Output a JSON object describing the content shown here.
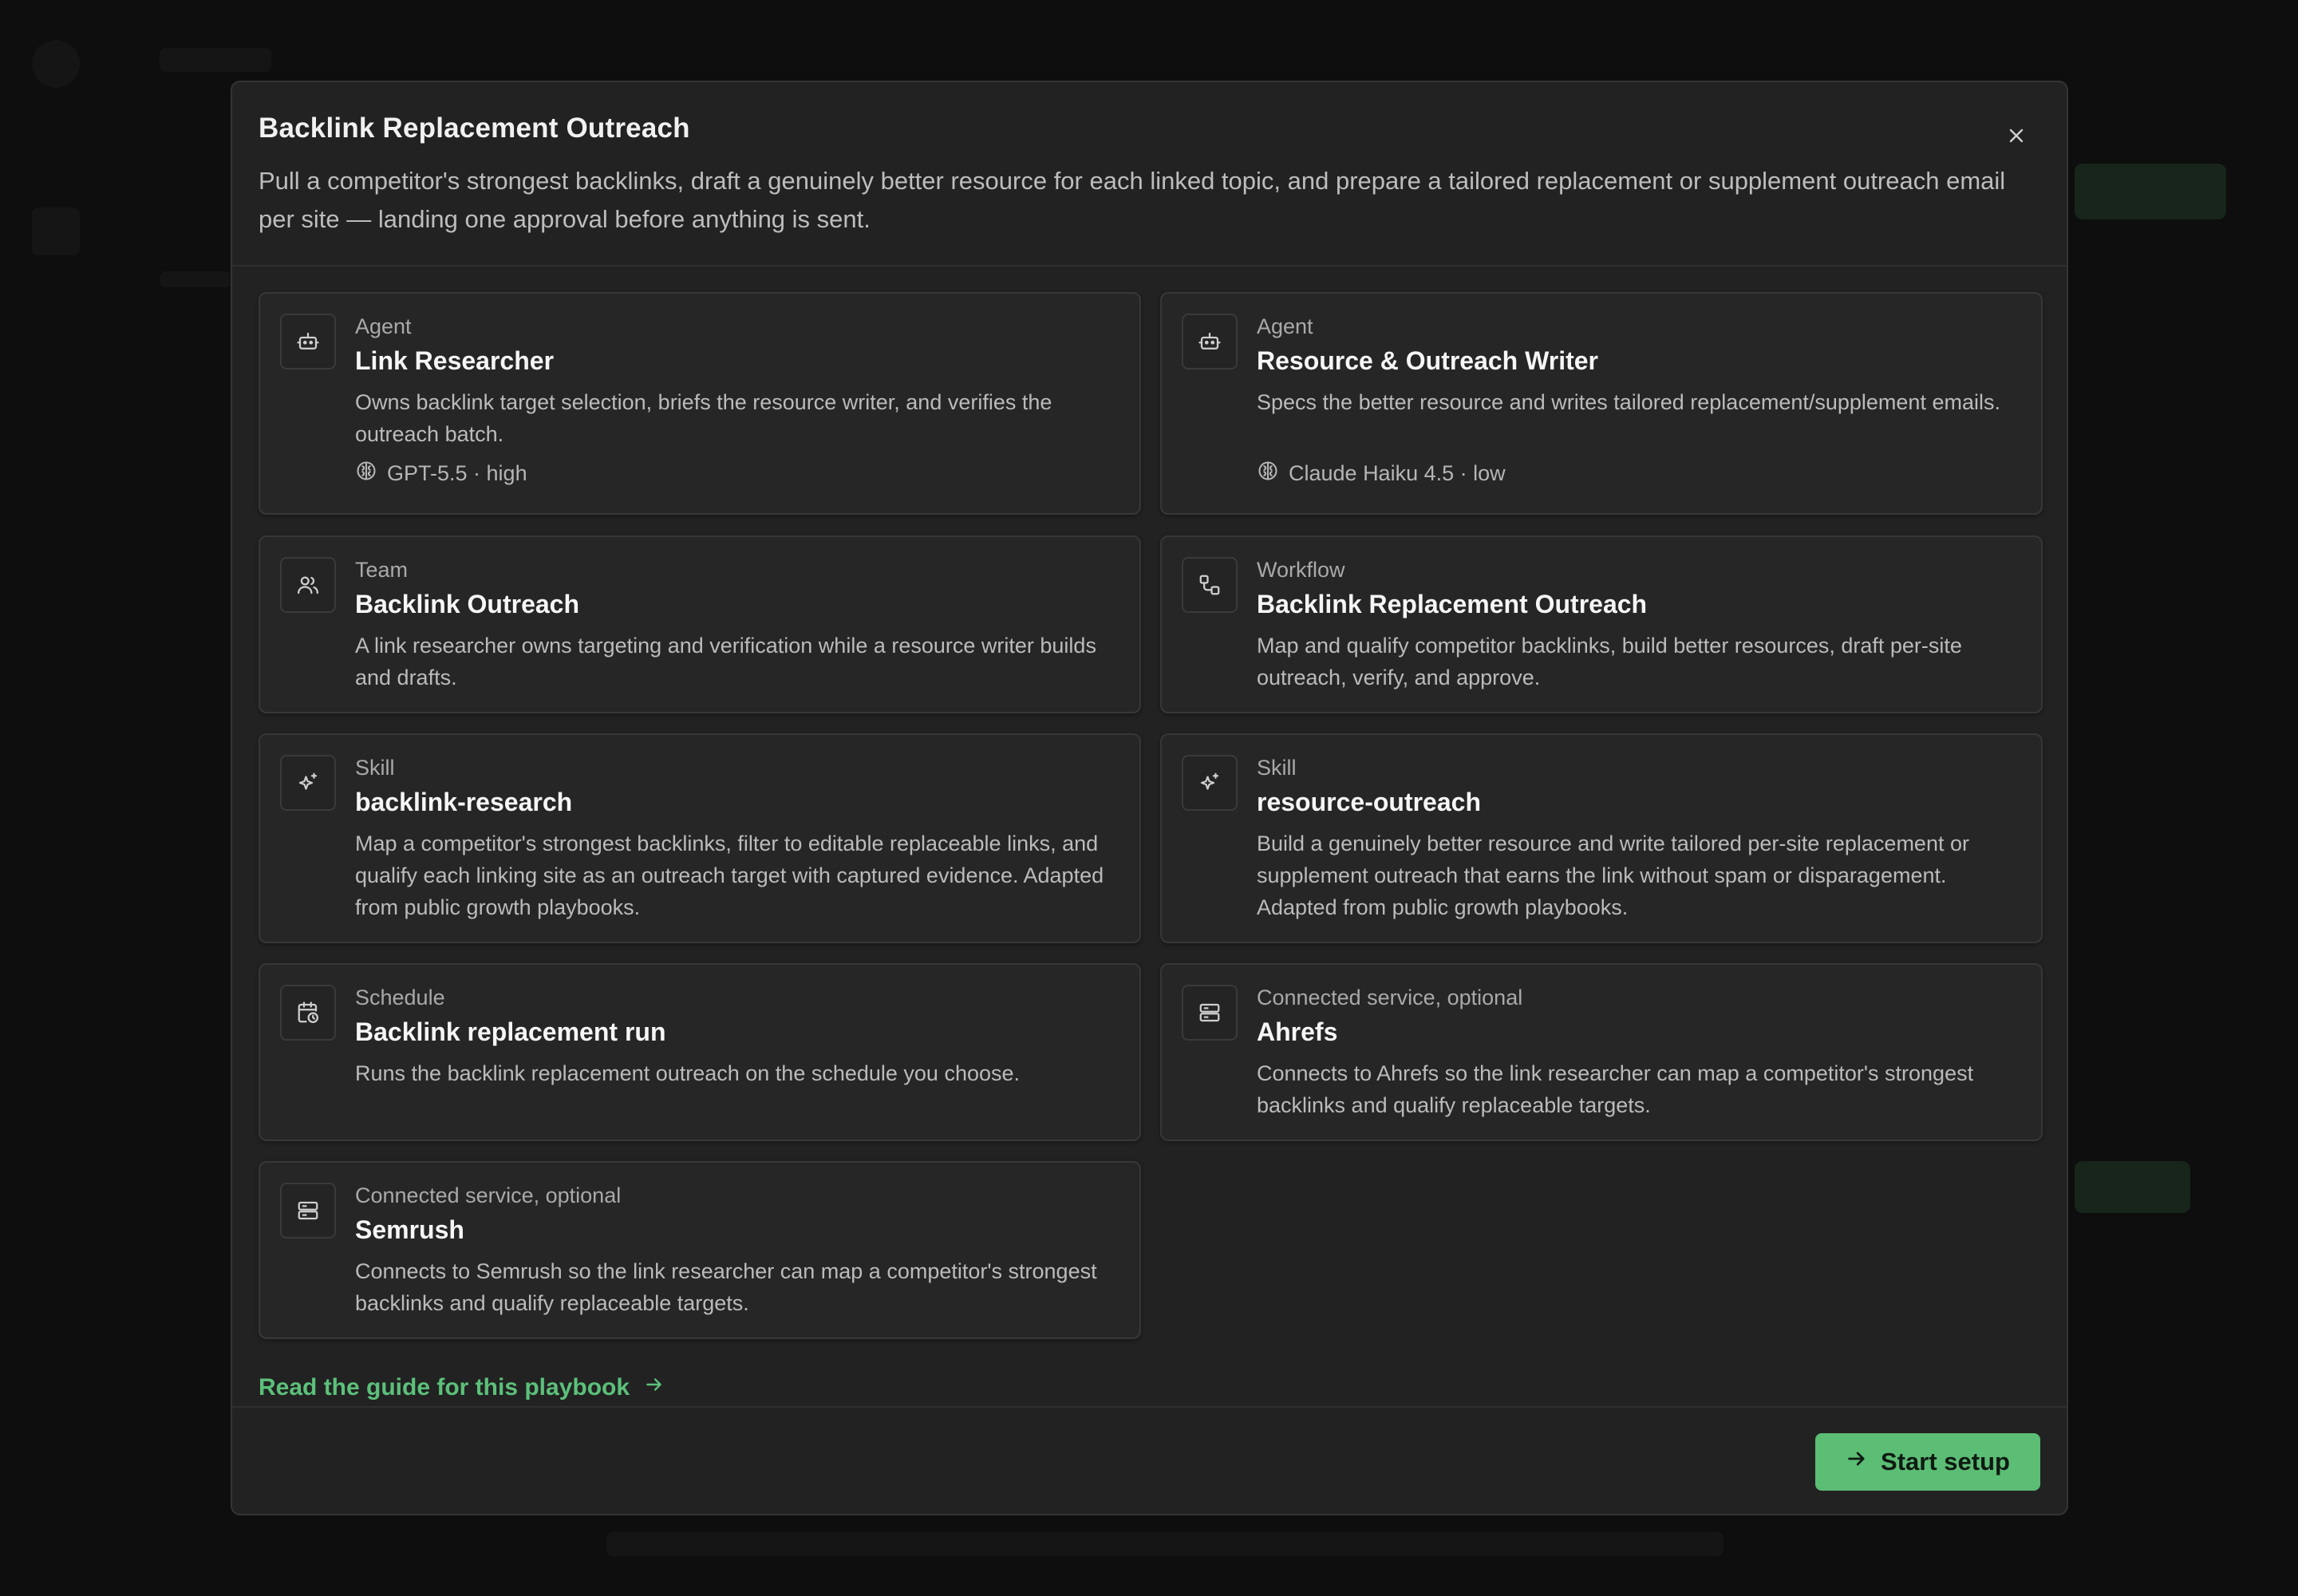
{
  "modal": {
    "title": "Backlink Replacement Outreach",
    "description": "Pull a competitor's strongest backlinks, draft a genuinely better resource for each linked topic, and prepare a tailored replacement or supplement outreach email per site — landing one approval before anything is sent.",
    "close_icon": "close-icon"
  },
  "cards": [
    {
      "icon": "robot-icon",
      "kind": "Agent",
      "name": "Link Researcher",
      "description": "Owns backlink target selection, briefs the resource writer, and verifies the outreach batch.",
      "model_icon": "brain-icon",
      "model": "GPT-5.5 · high"
    },
    {
      "icon": "robot-icon",
      "kind": "Agent",
      "name": "Resource & Outreach Writer",
      "description": "Specs the better resource and writes tailored replacement/supplement emails.",
      "model_icon": "brain-icon",
      "model": "Claude Haiku 4.5 · low"
    },
    {
      "icon": "users-icon",
      "kind": "Team",
      "name": "Backlink Outreach",
      "description": "A link researcher owns targeting and verification while a resource writer builds and drafts."
    },
    {
      "icon": "workflow-icon",
      "kind": "Workflow",
      "name": "Backlink Replacement Outreach",
      "description": "Map and qualify competitor backlinks, build better resources, draft per-site outreach, verify, and approve."
    },
    {
      "icon": "sparkles-icon",
      "kind": "Skill",
      "name": "backlink-research",
      "description": "Map a competitor's strongest backlinks, filter to editable replaceable links, and qualify each linking site as an outreach target with captured evidence. Adapted from public growth playbooks."
    },
    {
      "icon": "sparkles-icon",
      "kind": "Skill",
      "name": "resource-outreach",
      "description": "Build a genuinely better resource and write tailored per-site replacement or supplement outreach that earns the link without spam or disparagement. Adapted from public growth playbooks."
    },
    {
      "icon": "calendar-clock-icon",
      "kind": "Schedule",
      "name": "Backlink replacement run",
      "description": "Runs the backlink replacement outreach on the schedule you choose."
    },
    {
      "icon": "server-icon",
      "kind": "Connected service, optional",
      "name": "Ahrefs",
      "description": "Connects to Ahrefs so the link researcher can map a competitor's strongest backlinks and qualify replaceable targets."
    },
    {
      "icon": "server-icon",
      "kind": "Connected service, optional",
      "name": "Semrush",
      "description": "Connects to Semrush so the link researcher can map a competitor's strongest backlinks and qualify replaceable targets."
    }
  ],
  "footer": {
    "guide_link": "Read the guide for this playbook",
    "guide_icon": "arrow-right-icon",
    "start_button": "Start setup",
    "start_icon": "arrow-right-icon"
  },
  "colors": {
    "accent": "#5cbd75",
    "link": "#5cc07a",
    "modal_bg": "#222222",
    "card_bg": "#262626"
  }
}
